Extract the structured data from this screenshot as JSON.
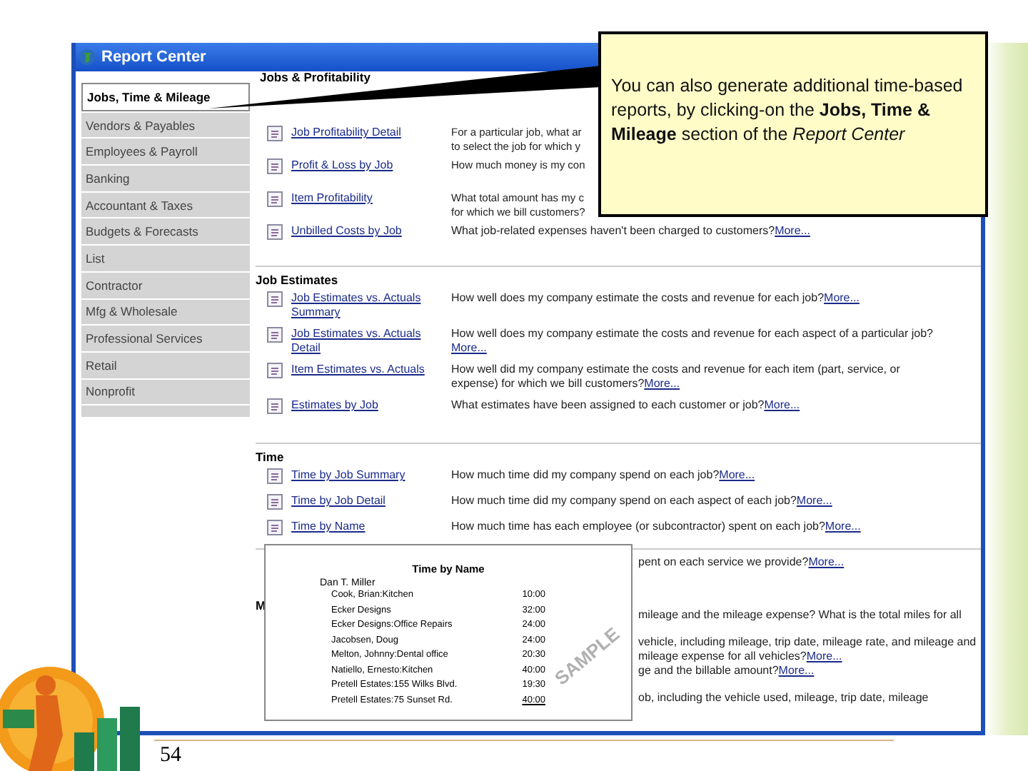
{
  "window": {
    "title": "Report Center"
  },
  "sidebar": {
    "items": [
      {
        "label": "Jobs, Time & Mileage",
        "selected": true
      },
      {
        "label": "Vendors & Payables",
        "selected": false
      },
      {
        "label": "Employees & Payroll",
        "selected": false
      },
      {
        "label": "Banking",
        "selected": false
      },
      {
        "label": "Accountant & Taxes",
        "selected": false
      },
      {
        "label": "Budgets & Forecasts",
        "selected": false
      },
      {
        "label": "List",
        "selected": false
      },
      {
        "label": "Contractor",
        "selected": false
      },
      {
        "label": "Mfg & Wholesale",
        "selected": false
      },
      {
        "label": "Professional Services",
        "selected": false
      },
      {
        "label": "Retail",
        "selected": false
      },
      {
        "label": "Nonprofit",
        "selected": false
      }
    ]
  },
  "sections": [
    {
      "heading": "Jobs & Profitability",
      "reports": [
        {
          "name": "Job Profitability Detail",
          "lines": [
            "For a particular job, what ar",
            "to select the job for which y"
          ]
        },
        {
          "name": "Profit & Loss by Job",
          "lines": [
            "How much money is my con"
          ]
        },
        {
          "name": "Item Profitability",
          "lines": [
            "What total amount has my c",
            "for which we bill customers?"
          ]
        },
        {
          "name": "Unbilled Costs by Job",
          "description": "What job-related expenses haven't been charged to customers?",
          "more": "More..."
        }
      ]
    },
    {
      "heading": "Job Estimates",
      "reports": [
        {
          "name": "Job Estimates vs. Actuals Summary",
          "description": "How well does my company estimate the costs and revenue for each job?",
          "more": "More..."
        },
        {
          "name": "Job Estimates vs. Actuals Detail",
          "description": "How well does my company estimate the costs and revenue for each aspect of a particular job?",
          "more": "More..."
        },
        {
          "name": "Item Estimates vs. Actuals",
          "description": "How well did my company estimate the costs and revenue for each item (part, service, or expense) for which we bill customers?",
          "more": "More..."
        },
        {
          "name": "Estimates by Job",
          "description": "What estimates have been assigned to each customer or job?",
          "more": "More..."
        }
      ]
    },
    {
      "heading": "Time",
      "reports": [
        {
          "name": "Time by Job Summary",
          "description": "How much time did my company spend on each job?",
          "more": "More..."
        },
        {
          "name": "Time by Job Detail",
          "description": "How much time did my company spend on each aspect of each job?",
          "more": "More..."
        },
        {
          "name": "Time by Name",
          "description": "How much time has each employee (or subcontractor) spent on each job?",
          "more": "More..."
        }
      ]
    }
  ],
  "partial_rows": [
    {
      "text": "pent on each service we provide?",
      "more": "More..."
    },
    {
      "text": "mileage and the mileage expense? What is the total miles for all"
    },
    {
      "text": "vehicle, including mileage, trip date, mileage rate, and mileage and mileage expense for all vehicles?",
      "more": "More..."
    },
    {
      "text": "ge and the billable amount?",
      "more": "More..."
    },
    {
      "text": "ob, including the vehicle used, mileage, trip date, mileage"
    }
  ],
  "partial_heading": "M",
  "preview": {
    "title": "Time by Name",
    "watermark": "SAMPLE",
    "person": "Dan T. Miller",
    "rows": [
      {
        "name": "Cook, Brian:Kitchen",
        "hours": "10:00"
      },
      {
        "name": "Ecker Designs",
        "hours": "32:00"
      },
      {
        "name": "Ecker Designs:Office Repairs",
        "hours": "24:00"
      },
      {
        "name": "Jacobsen, Doug",
        "hours": "24:00"
      },
      {
        "name": "Melton, Johnny:Dental office",
        "hours": "20:30"
      },
      {
        "name": "Natiello, Ernesto:Kitchen",
        "hours": "40:00"
      },
      {
        "name": "Pretell Estates:155 Wilks Blvd.",
        "hours": "19:30"
      },
      {
        "name": "Pretell Estates:75 Sunset Rd.",
        "hours": "40:00"
      }
    ]
  },
  "callout": {
    "text": "You can also generate additional time-based reports, by clicking-on the **Jobs, Time & Mileage** section of the *Report Center*"
  },
  "slide_number": "54"
}
